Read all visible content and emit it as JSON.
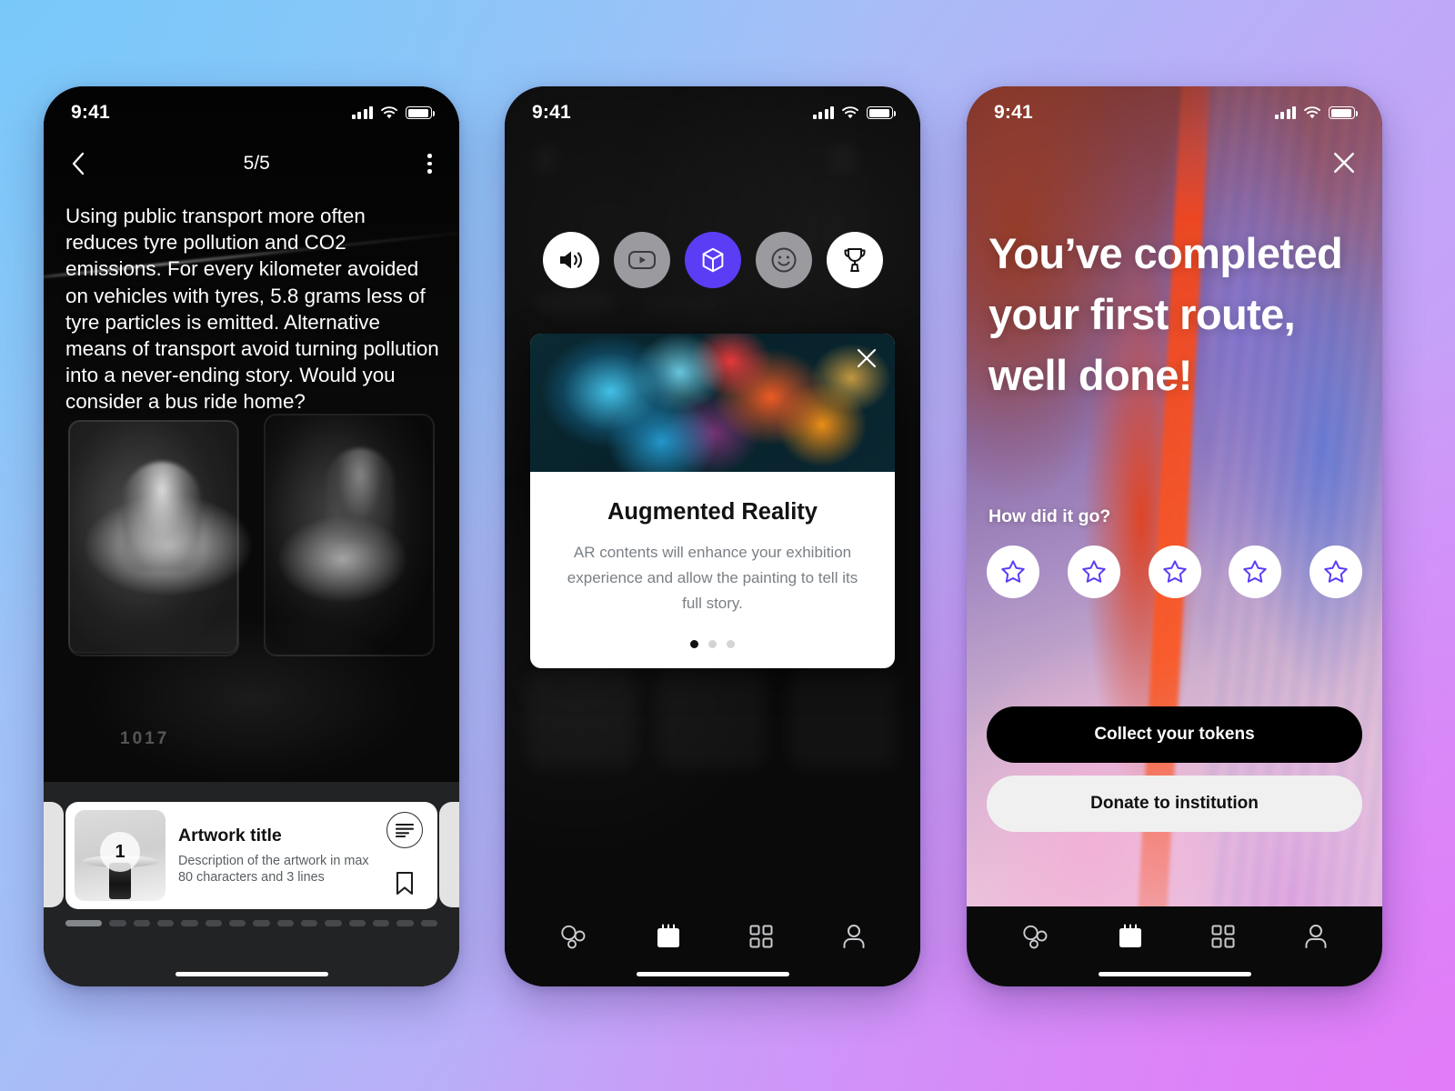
{
  "background": {
    "gradient_from": "#8fcaf7",
    "gradient_to": "#d68ff8"
  },
  "theme": {
    "accent_purple": "#5B3DF5",
    "dark": "#0a0a0a",
    "tray": "#222325"
  },
  "status_bar": {
    "time": "9:41",
    "signal_icon": "cellular-signal-icon",
    "wifi_icon": "wifi-icon",
    "battery_icon": "battery-icon"
  },
  "phone1": {
    "name": "story-screen",
    "back_icon": "back-chevron-icon",
    "page_counter": "5/5",
    "overflow_icon": "more-options-icon",
    "body_text": "Using public transport more often reduces tyre pollution and CO2 emissions. For every kilometer avoided on vehicles with tyres, 5.8 grams less of tyre particles is emitted. Alternative means of transport avoid turning pollution into a never-ending story. Would you consider a bus ride home?",
    "photo_number": "1017",
    "pager": {
      "total": 5,
      "active": 5
    },
    "fab_icon": "ar-cube-icon",
    "card": {
      "thumb_badge": "1",
      "title": "Artwork title",
      "description": "Description of the artwork in max 80 characters and 3 lines",
      "text_icon": "text-lines-icon",
      "bookmark_icon": "bookmark-icon"
    },
    "scrubber": {
      "segments": 16,
      "active_index": 0
    }
  },
  "phone2": {
    "name": "ar-modal-screen",
    "icons": [
      {
        "name": "audio-icon",
        "style": "white"
      },
      {
        "name": "video-icon",
        "style": "gray"
      },
      {
        "name": "ar-cube-icon",
        "style": "purple"
      },
      {
        "name": "smiley-icon",
        "style": "gray"
      },
      {
        "name": "trophy-icon",
        "style": "white"
      }
    ],
    "modal": {
      "close_icon": "close-icon",
      "title": "Augmented Reality",
      "subtitle": "AR contents will enhance your exhibition experience and allow the painting to tell its full story.",
      "pager": {
        "total": 3,
        "active": 1
      }
    },
    "tabs": [
      {
        "name": "explore-tab",
        "icon": "bubbles-icon",
        "active": false
      },
      {
        "name": "calendar-tab",
        "icon": "calendar-icon",
        "active": true
      },
      {
        "name": "grid-tab",
        "icon": "grid-icon",
        "active": false
      },
      {
        "name": "profile-tab",
        "icon": "person-icon",
        "active": false
      }
    ]
  },
  "phone3": {
    "name": "route-complete-screen",
    "close_icon": "close-icon",
    "headline": "You’ve completed your first route, well done!",
    "rating_label": "How did it go?",
    "stars": [
      {
        "name": "star-1",
        "icon": "star-outline-icon"
      },
      {
        "name": "star-2",
        "icon": "star-outline-icon"
      },
      {
        "name": "star-3",
        "icon": "star-outline-icon"
      },
      {
        "name": "star-4",
        "icon": "star-outline-icon"
      },
      {
        "name": "star-5",
        "icon": "star-outline-icon"
      }
    ],
    "primary_button": "Collect your tokens",
    "secondary_button": "Donate to institution",
    "tabs": [
      {
        "name": "explore-tab",
        "icon": "bubbles-icon",
        "active": false
      },
      {
        "name": "calendar-tab",
        "icon": "calendar-icon",
        "active": true
      },
      {
        "name": "grid-tab",
        "icon": "grid-icon",
        "active": false
      },
      {
        "name": "profile-tab",
        "icon": "person-icon",
        "active": false
      }
    ]
  }
}
